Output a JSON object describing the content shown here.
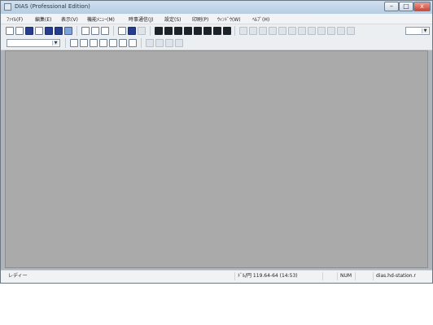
{
  "window": {
    "title": "DIAS (Professional Edition)"
  },
  "menu": [
    "ﾌｧｲﾙ(F)",
    "編集(E)",
    "表示(V)",
    "機能ﾒﾆｭｰ(M)",
    "時事通信(J)",
    "設定(S)",
    "印刷(P)",
    "ｳｨﾝﾄﾞｳ(W)",
    "ﾍﾙﾌﾟ(H)"
  ],
  "toolbar": {
    "row1_chars": [
      "株",
      "業",
      "外",
      "先",
      "金",
      "取",
      "解",
      "図"
    ],
    "row2_chars": [
      "Ab",
      "総",
      "具",
      "時",
      "経",
      "株",
      "Ab"
    ]
  },
  "status": {
    "ready_text": "レディー",
    "quote": "ﾄﾞﾙ/円 119.64-64 (14:53)",
    "num": "NUM",
    "server": "dias.hd-station.r"
  }
}
